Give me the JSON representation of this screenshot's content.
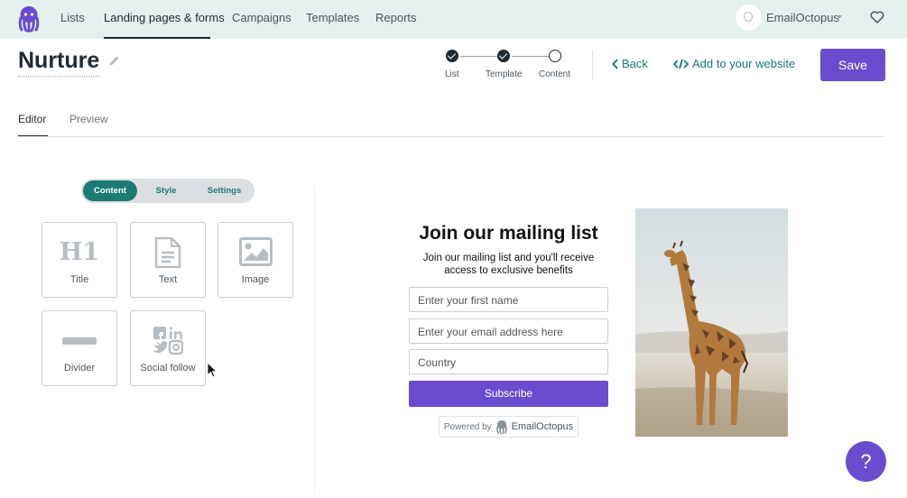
{
  "nav": {
    "items": [
      "Lists",
      "Landing pages & forms",
      "Campaigns",
      "Templates",
      "Reports"
    ],
    "active": "Landing pages & forms",
    "account": {
      "avatar_initial": "O",
      "name": "EmailOctopus"
    }
  },
  "header": {
    "title": "Nurture",
    "steps": [
      {
        "label": "List",
        "state": "done"
      },
      {
        "label": "Template",
        "state": "done"
      },
      {
        "label": "Content",
        "state": "current"
      }
    ],
    "back_label": "Back",
    "embed_label": "Add to your website",
    "save_label": "Save"
  },
  "tabs": {
    "items": [
      "Editor",
      "Preview"
    ],
    "active": "Editor"
  },
  "panel": {
    "segments": [
      "Content",
      "Style",
      "Settings"
    ],
    "active_segment": "Content",
    "blocks": [
      {
        "label": "Title",
        "icon": "heading-h1-icon"
      },
      {
        "label": "Text",
        "icon": "document-text-icon"
      },
      {
        "label": "Image",
        "icon": "image-icon"
      },
      {
        "label": "Divider",
        "icon": "divider-icon"
      },
      {
        "label": "Social follow",
        "icon": "social-icons"
      }
    ],
    "h1_glyph": "H1"
  },
  "form": {
    "heading": "Join our mailing list",
    "description": "Join our mailing list and you'll receive access to exclusive benefits",
    "fields": [
      "Enter your first name",
      "Enter your email address here",
      "Country"
    ],
    "subscribe_label": "Subscribe",
    "powered_by": "Powered by",
    "powered_brand": "EmailOctopus",
    "image_alt": "giraffe"
  },
  "help": {
    "label": "?"
  },
  "colors": {
    "primary": "#6a4ccf",
    "teal": "#1b7a72",
    "nav_bg": "#e4f0ee"
  }
}
